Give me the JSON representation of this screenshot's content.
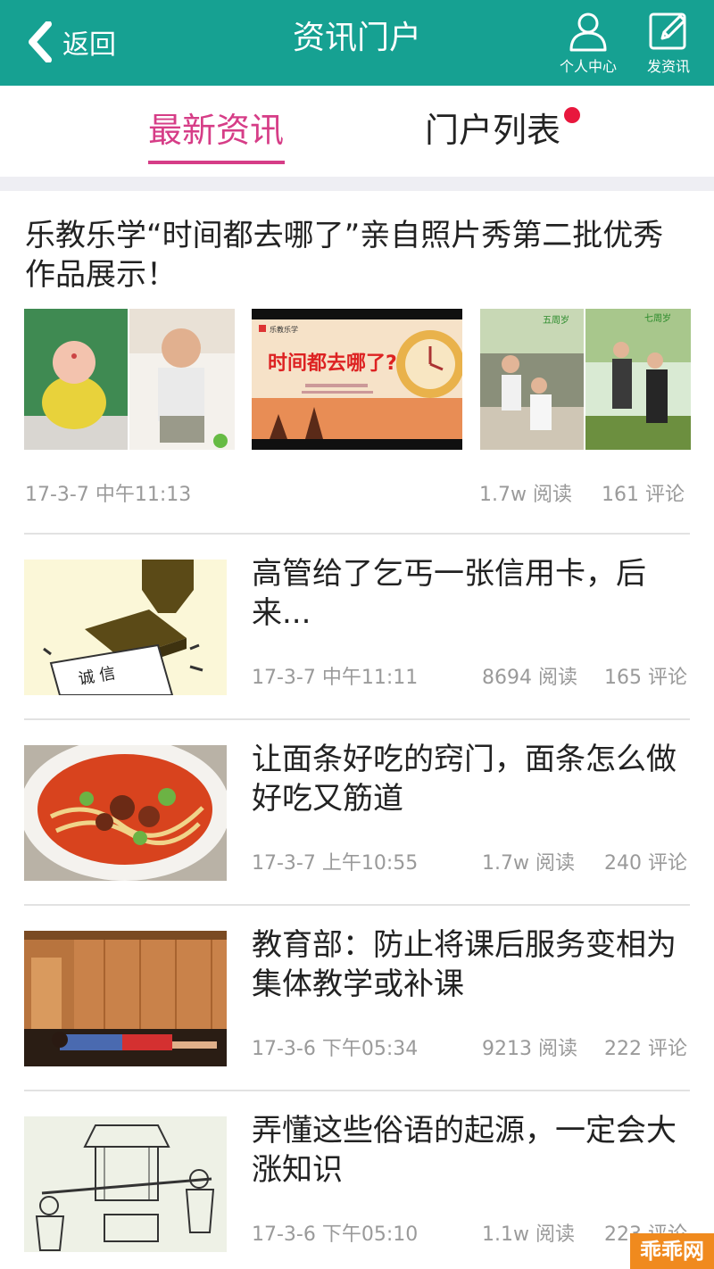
{
  "header": {
    "back_label": "返回",
    "title": "资讯门户",
    "profile_label": "个人中心",
    "post_label": "发资讯",
    "color": "#16a192"
  },
  "tabs": [
    {
      "label": "最新资讯",
      "active": true
    },
    {
      "label": "门户列表",
      "active": false,
      "has_badge": true
    }
  ],
  "feature": {
    "title": "乐教乐学“时间都去哪了”亲自照片秀第二批优秀作品展示！",
    "time": "17-3-7 中午11:13",
    "reads": "1.7w 阅读",
    "comments": "161 评论",
    "image2_text": "时间都去哪了?",
    "image2_brand": "乐教乐学",
    "image3_left": "五周岁",
    "image3_right": "七周岁"
  },
  "articles": [
    {
      "title": "高管给了乞丐一张信用卡，后来...",
      "time": "17-3-7 中午11:11",
      "reads": "8694 阅读",
      "comments": "165 评论",
      "thumb_text": "诚 信"
    },
    {
      "title": "让面条好吃的窍门，面条怎么做好吃又筋道",
      "time": "17-3-7 上午10:55",
      "reads": "1.7w 阅读",
      "comments": "240 评论"
    },
    {
      "title": "教育部：防止将课后服务变相为集体教学或补课",
      "time": "17-3-6 下午05:34",
      "reads": "9213 阅读",
      "comments": "222 评论"
    },
    {
      "title": "弄懂这些俗语的起源，一定会大涨知识",
      "time": "17-3-6 下午05:10",
      "reads": "1.1w 阅读",
      "comments": "223 评论"
    }
  ],
  "watermark": "乖乖网",
  "colors": {
    "accent": "#d63d87",
    "badge": "#e8173d",
    "meta": "#9a9a9a"
  }
}
